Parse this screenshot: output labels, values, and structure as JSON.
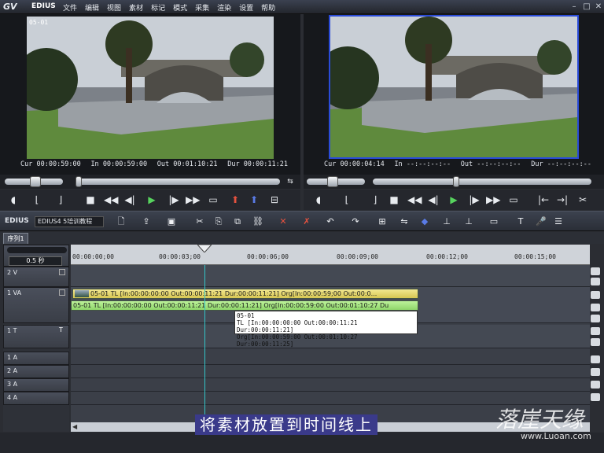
{
  "app": {
    "name": "EDIUS"
  },
  "menu": [
    "文件",
    "编辑",
    "视图",
    "素材",
    "标记",
    "模式",
    "采集",
    "渲染",
    "设置",
    "帮助"
  ],
  "player": {
    "clip_name": "05-01",
    "cur_label": "Cur",
    "cur": "00:00:59:00",
    "in_label": "In",
    "in": "00:00:59:00",
    "out_label": "Out",
    "out": "00:01:10:21",
    "dur_label": "Dur",
    "dur": "00:00:11:21"
  },
  "recorder": {
    "cur_label": "Cur",
    "cur": "00:00:04:14",
    "in_label": "In",
    "in": "--:--:--:--",
    "out_label": "Out",
    "out": "--:--:--:--",
    "dur_label": "Dur",
    "dur": "--:--:--:--"
  },
  "toolbar": {
    "logo": "EDIUS",
    "project_name": "EDIUS4 5培训教程"
  },
  "sequence": {
    "tab": "序列1"
  },
  "timeline": {
    "scale": "0.5 秒",
    "ruler_ticks": [
      "00:00:00;00",
      "00:00:03;00",
      "00:00:06;00",
      "00:00:09;00",
      "00:00:12;00",
      "00:00:15;00"
    ],
    "tracks": [
      {
        "name": "2 V"
      },
      {
        "name": "1 VA"
      },
      {
        "name": "1 T"
      },
      {
        "name": "1 A"
      },
      {
        "name": "2 A"
      },
      {
        "name": "3 A"
      },
      {
        "name": "4 A"
      }
    ],
    "video_clip": "05-01  TL [In:00:00:00:00 Out:00:00:11:21 Dur:00:00:11:21]  Org[In:00:00:59;00 Out:00:0...",
    "audio_clip": "05-01  TL [In:00:00:00:00 Out:00:00:11:21 Dur:00:00:11:21]  Org[In:00:00:59:00 Out:00:01:10:27 Du",
    "tooltip": {
      "line1": "05-01",
      "line2": "TL [In:00:00:00:00 Out:00:00:11:21 Dur:00:00:11:21]",
      "line3": "Org[In:00:00:59:00 Out:00:01:10:27 Dur:00:00:11:25]"
    }
  },
  "overlay": {
    "subtitle": "将素材放置到时间线上",
    "watermark": "落崖天缘",
    "watermark_url": "www.Luoan.com"
  }
}
